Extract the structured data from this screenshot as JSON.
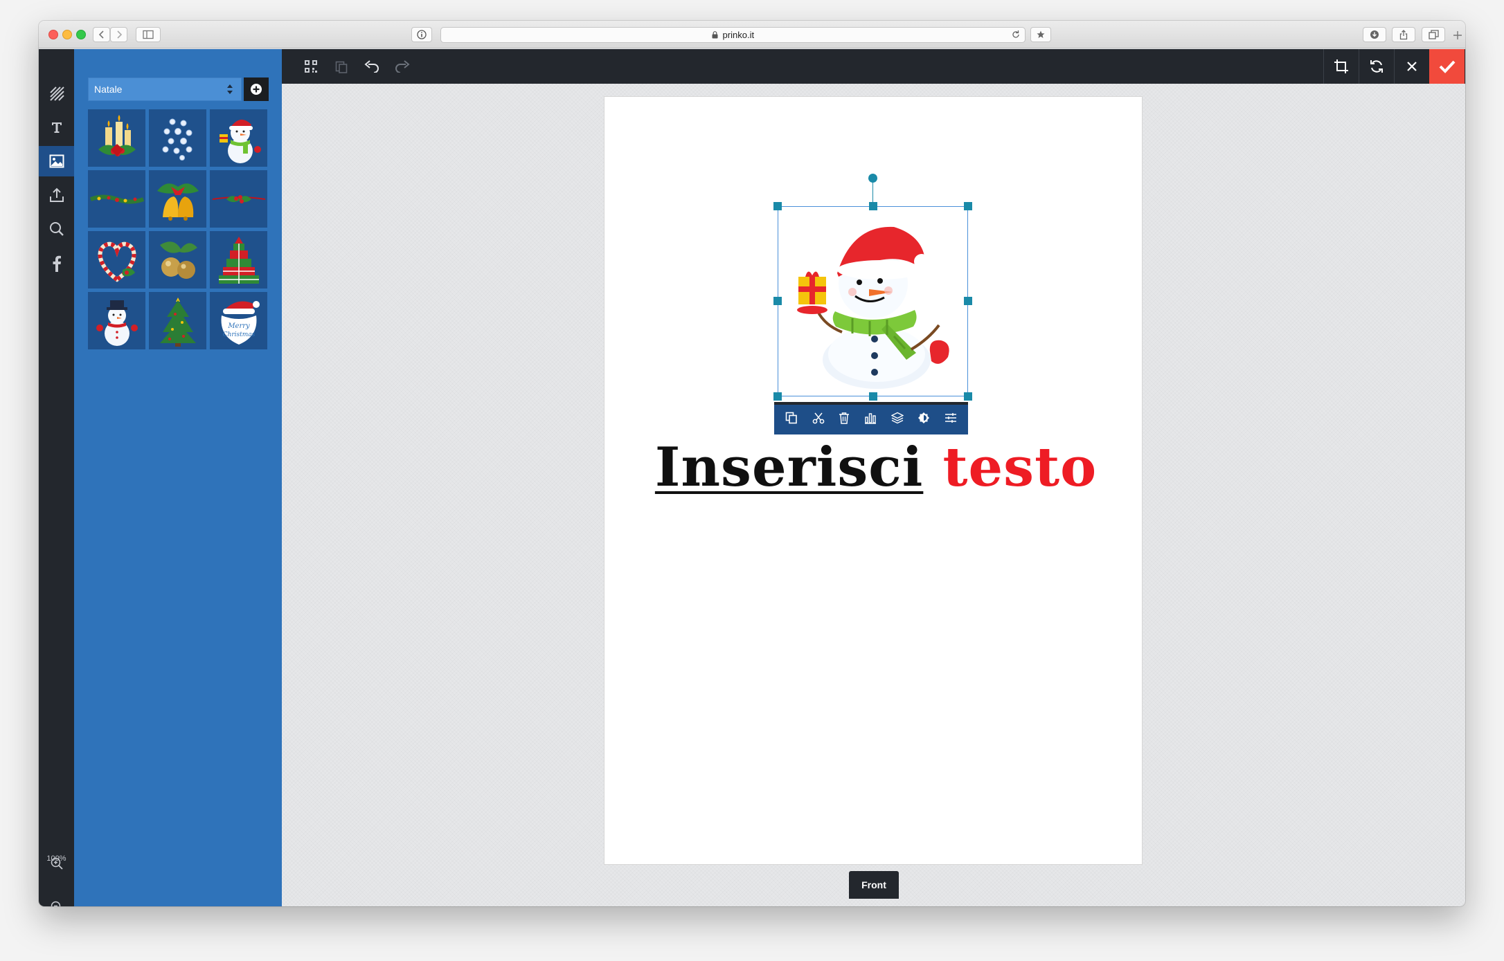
{
  "browser": {
    "url": "prinko.it"
  },
  "sidebar_rail": {
    "items": [
      {
        "name": "patterns",
        "icon": "stripes-icon"
      },
      {
        "name": "text",
        "icon": "text-icon"
      },
      {
        "name": "images",
        "icon": "image-icon",
        "active": true
      },
      {
        "name": "upload",
        "icon": "upload-icon"
      },
      {
        "name": "search",
        "icon": "search-icon"
      },
      {
        "name": "facebook",
        "icon": "facebook-icon"
      }
    ],
    "zoom_level": "100%"
  },
  "clipart_panel": {
    "category": "Natale",
    "items": [
      "candles-with-holly",
      "snowflakes",
      "snowman-with-gift",
      "garland",
      "golden-bells",
      "berry-garland",
      "candy-cane-heart",
      "golden-ornaments",
      "gift-stack-tree",
      "snowman-with-hat",
      "christmas-tree",
      "merry-christmas-santa"
    ]
  },
  "canvas": {
    "text_word_1": "Inserisci",
    "text_word_2": "testo",
    "side_tab": "Front"
  },
  "colors": {
    "dark": "#23272d",
    "panel_blue": "#2f73ba",
    "accent_red": "#f14a3c",
    "text_red": "#ee1c24",
    "handle_teal": "#1a8aa8"
  }
}
